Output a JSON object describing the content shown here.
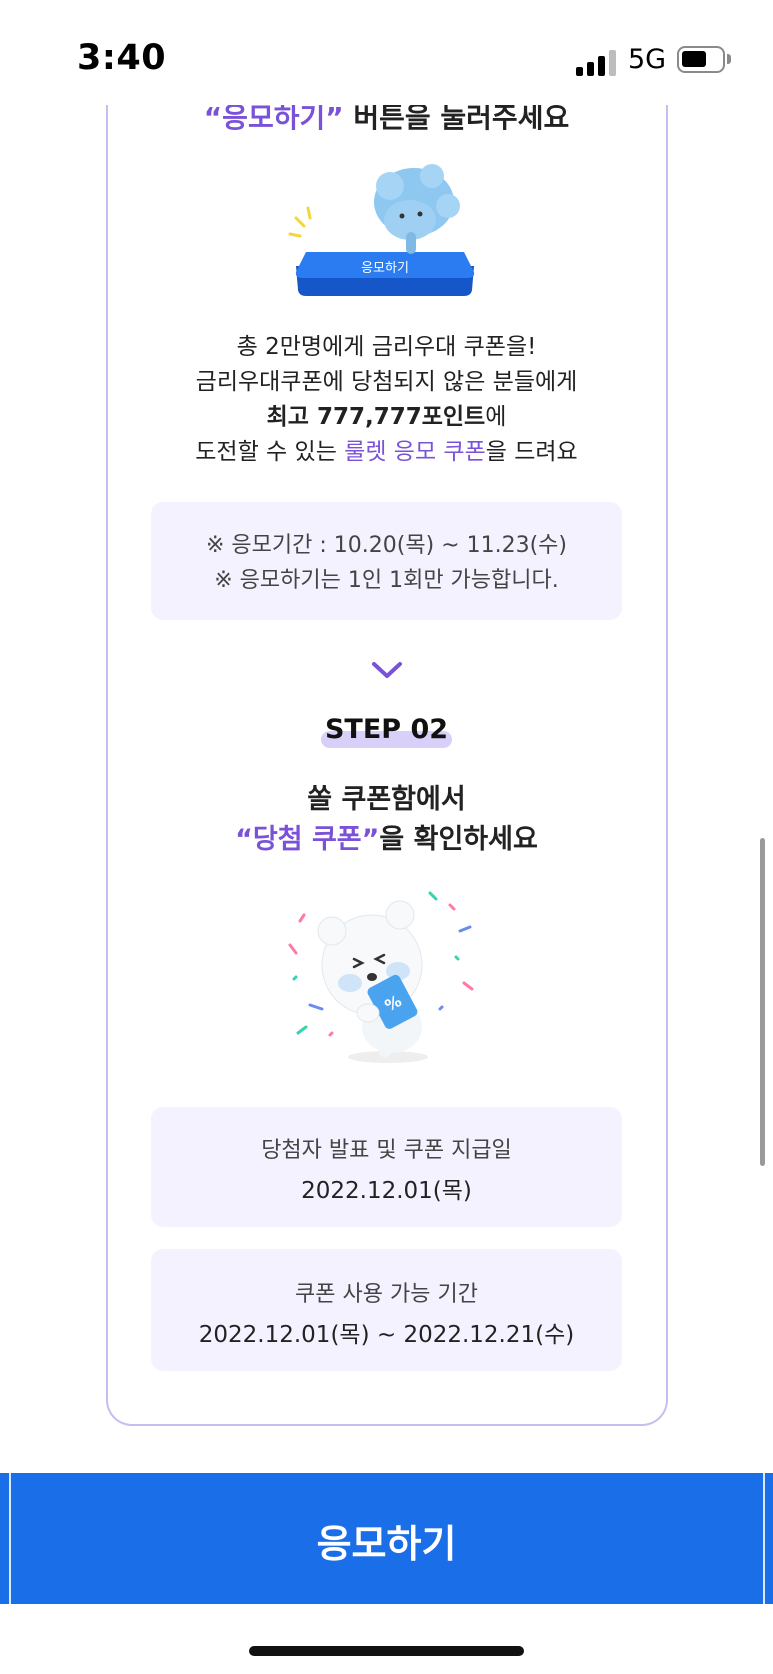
{
  "status_bar": {
    "time": "3:40",
    "network": "5G",
    "icons": [
      "signal-icon",
      "battery-icon"
    ]
  },
  "step1": {
    "instruction_highlight": "“응모하기”",
    "instruction_rest": " 버튼을 눌러주세요",
    "illustration_button_label": "응모하기",
    "desc_line1": "총 2만명에게 금리우대 쿠폰을!",
    "desc_line2": "금리우대쿠폰에 당첨되지 않은 분들에게",
    "desc_line3_bold": "최고 777,777포인트",
    "desc_line3_rest": "에",
    "desc_line4_pre": "도전할 수 있는 ",
    "desc_line4_highlight": "룰렛 응모 쿠폰",
    "desc_line4_post": "을 드려요",
    "period_line1": "※ 응모기간 : 10.20(목) ~ 11.23(수)",
    "period_line2": "※ 응모하기는 1인 1회만 가능합니다."
  },
  "step2": {
    "badge": "STEP 02",
    "title_line1": "쏠 쿠폰함에서",
    "title_highlight": "“당첨 쿠폰”",
    "title_rest": "을 확인하세요",
    "coupon_symbol": "%",
    "winner_label": "당첨자 발표 및 쿠폰 지급일",
    "winner_date": "2022.12.01(목)",
    "usage_label": "쿠폰 사용 가능 기간",
    "usage_period": "2022.12.01(목) ~ 2022.12.21(수)"
  },
  "cta": {
    "label": "응모하기"
  },
  "colors": {
    "accent_purple": "#7a52d8",
    "cta_blue": "#1a6fe8",
    "info_box_bg": "#f5f2ff",
    "card_border": "#c8bdf1"
  }
}
